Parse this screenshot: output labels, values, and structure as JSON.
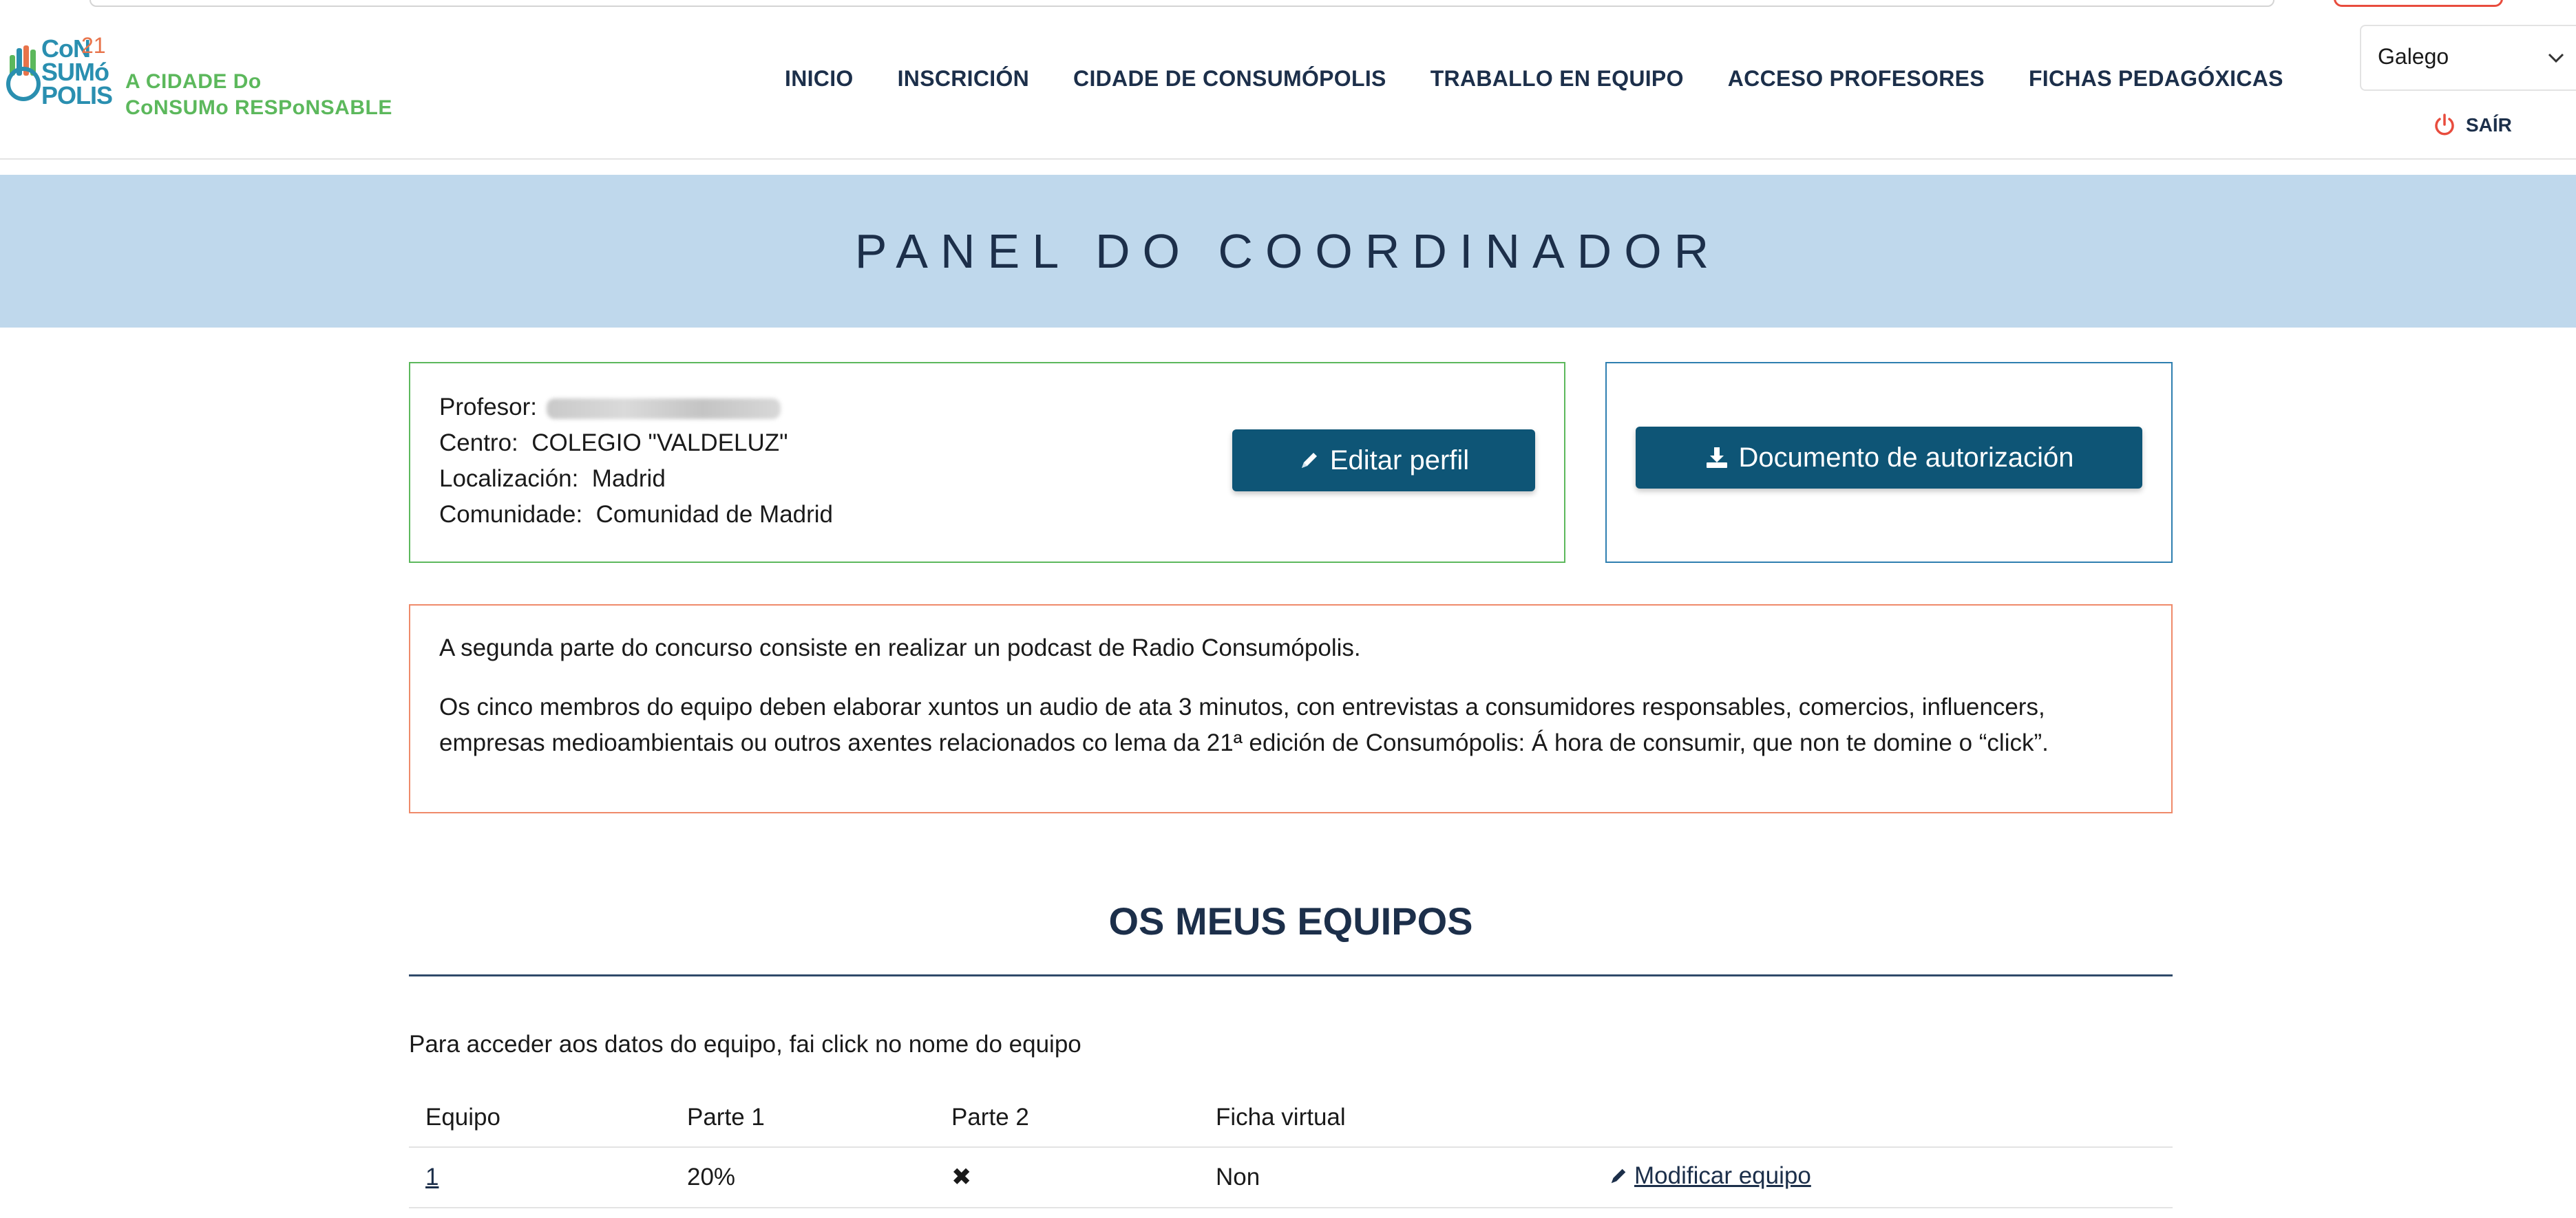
{
  "logo": {
    "word_line1": "CoN",
    "word_line2": "SUMó",
    "word_line3": "POLIS",
    "number": "21",
    "tagline_line1": "A CIDADE Do",
    "tagline_line2": "CoNSUMo RESPoNSABLE"
  },
  "nav": {
    "items": [
      {
        "label": "INICIO"
      },
      {
        "label": "INSCRICIÓN"
      },
      {
        "label": "CIDADE DE CONSUMÓPOLIS"
      },
      {
        "label": "TRABALLO EN EQUIPO"
      },
      {
        "label": "ACCESO PROFESORES"
      },
      {
        "label": "FICHAS PEDAGÓXICAS"
      }
    ]
  },
  "language": {
    "selected": "Galego"
  },
  "logout": {
    "label": "SAÍR"
  },
  "banner": {
    "title": "PANEL DO COORDINADOR"
  },
  "profile": {
    "teacher_label": "Profesor:",
    "center_label": "Centro:",
    "center_value": "COLEGIO \"VALDELUZ\"",
    "location_label": "Localización:",
    "location_value": "Madrid",
    "community_label": "Comunidade:",
    "community_value": "Comunidad de Madrid",
    "edit_button": "Editar perfil"
  },
  "document": {
    "button": "Documento de autorización"
  },
  "notice": {
    "p1": "A segunda parte do concurso consiste en realizar un podcast de Radio Consumópolis.",
    "p2": "Os cinco membros do equipo deben elaborar xuntos un audio de ata 3 minutos, con entrevistas a consumidores responsables, comercios, influencers, empresas medioambientais ou outros axentes relacionados co lema da 21ª edición de Consumópolis: Á hora de consumir, que non te domine o “click”."
  },
  "teams": {
    "title": "OS MEUS EQUIPOS",
    "hint": "Para acceder aos datos do equipo, fai click no nome do equipo",
    "columns": [
      "Equipo",
      "Parte 1",
      "Parte 2",
      "Ficha virtual"
    ],
    "rows": [
      {
        "team": "1",
        "part1": "20%",
        "part2": "✖",
        "virtual_card": "Non",
        "action": "Modificar equipo"
      }
    ]
  },
  "colors": {
    "primary": "#0e5576",
    "banner": "#bfd8ec",
    "heading": "#1c2f4a",
    "profile_border": "#5cb85c",
    "doc_border": "#2f7fb0",
    "notice_border": "#ef8a6a",
    "logout_icon": "#e84c3d"
  },
  "icons": {
    "edit": "pencil-icon",
    "download": "download-icon",
    "logout": "power-icon",
    "select": "chevron-down-icon"
  }
}
